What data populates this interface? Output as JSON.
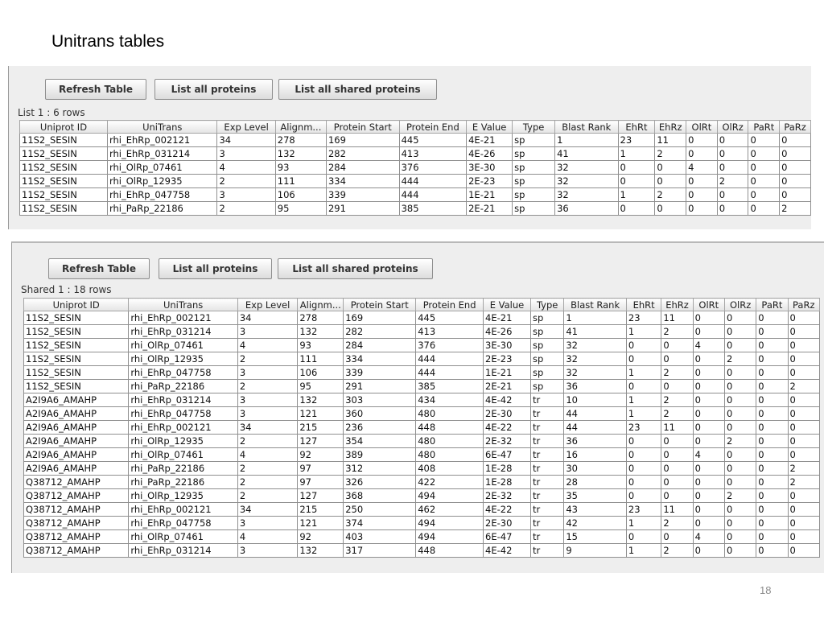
{
  "slide": {
    "title": "Unitrans tables",
    "page_number": "18"
  },
  "columns": [
    "Uniprot ID",
    "UniTrans",
    "Exp Level",
    "Alignm...",
    "Protein Start",
    "Protein End",
    "E Value",
    "Type",
    "Blast Rank",
    "EhRt",
    "EhRz",
    "OlRt",
    "OlRz",
    "PaRt",
    "PaRz"
  ],
  "buttons": {
    "refresh": "Refresh Table",
    "list_all": "List all proteins",
    "list_shared": "List all shared proteins"
  },
  "list_table": {
    "row_count_label": "List 1 : 6 rows",
    "rows": [
      [
        "11S2_SESIN",
        "rhi_EhRp_002121",
        "34",
        "278",
        "169",
        "445",
        "4E-21",
        "sp",
        "1",
        "23",
        "11",
        "0",
        "0",
        "0",
        "0"
      ],
      [
        "11S2_SESIN",
        "rhi_EhRp_031214",
        "3",
        "132",
        "282",
        "413",
        "4E-26",
        "sp",
        "41",
        "1",
        "2",
        "0",
        "0",
        "0",
        "0"
      ],
      [
        "11S2_SESIN",
        "rhi_OlRp_07461",
        "4",
        "93",
        "284",
        "376",
        "3E-30",
        "sp",
        "32",
        "0",
        "0",
        "4",
        "0",
        "0",
        "0"
      ],
      [
        "11S2_SESIN",
        "rhi_OlRp_12935",
        "2",
        "111",
        "334",
        "444",
        "2E-23",
        "sp",
        "32",
        "0",
        "0",
        "0",
        "2",
        "0",
        "0"
      ],
      [
        "11S2_SESIN",
        "rhi_EhRp_047758",
        "3",
        "106",
        "339",
        "444",
        "1E-21",
        "sp",
        "32",
        "1",
        "2",
        "0",
        "0",
        "0",
        "0"
      ],
      [
        "11S2_SESIN",
        "rhi_PaRp_22186",
        "2",
        "95",
        "291",
        "385",
        "2E-21",
        "sp",
        "36",
        "0",
        "0",
        "0",
        "0",
        "0",
        "2"
      ]
    ]
  },
  "shared_table": {
    "row_count_label": "Shared 1 : 18 rows",
    "rows": [
      [
        "11S2_SESIN",
        "rhi_EhRp_002121",
        "34",
        "278",
        "169",
        "445",
        "4E-21",
        "sp",
        "1",
        "23",
        "11",
        "0",
        "0",
        "0",
        "0"
      ],
      [
        "11S2_SESIN",
        "rhi_EhRp_031214",
        "3",
        "132",
        "282",
        "413",
        "4E-26",
        "sp",
        "41",
        "1",
        "2",
        "0",
        "0",
        "0",
        "0"
      ],
      [
        "11S2_SESIN",
        "rhi_OlRp_07461",
        "4",
        "93",
        "284",
        "376",
        "3E-30",
        "sp",
        "32",
        "0",
        "0",
        "4",
        "0",
        "0",
        "0"
      ],
      [
        "11S2_SESIN",
        "rhi_OlRp_12935",
        "2",
        "111",
        "334",
        "444",
        "2E-23",
        "sp",
        "32",
        "0",
        "0",
        "0",
        "2",
        "0",
        "0"
      ],
      [
        "11S2_SESIN",
        "rhi_EhRp_047758",
        "3",
        "106",
        "339",
        "444",
        "1E-21",
        "sp",
        "32",
        "1",
        "2",
        "0",
        "0",
        "0",
        "0"
      ],
      [
        "11S2_SESIN",
        "rhi_PaRp_22186",
        "2",
        "95",
        "291",
        "385",
        "2E-21",
        "sp",
        "36",
        "0",
        "0",
        "0",
        "0",
        "0",
        "2"
      ],
      [
        "A2I9A6_AMAHP",
        "rhi_EhRp_031214",
        "3",
        "132",
        "303",
        "434",
        "4E-42",
        "tr",
        "10",
        "1",
        "2",
        "0",
        "0",
        "0",
        "0"
      ],
      [
        "A2I9A6_AMAHP",
        "rhi_EhRp_047758",
        "3",
        "121",
        "360",
        "480",
        "2E-30",
        "tr",
        "44",
        "1",
        "2",
        "0",
        "0",
        "0",
        "0"
      ],
      [
        "A2I9A6_AMAHP",
        "rhi_EhRp_002121",
        "34",
        "215",
        "236",
        "448",
        "4E-22",
        "tr",
        "44",
        "23",
        "11",
        "0",
        "0",
        "0",
        "0"
      ],
      [
        "A2I9A6_AMAHP",
        "rhi_OlRp_12935",
        "2",
        "127",
        "354",
        "480",
        "2E-32",
        "tr",
        "36",
        "0",
        "0",
        "0",
        "2",
        "0",
        "0"
      ],
      [
        "A2I9A6_AMAHP",
        "rhi_OlRp_07461",
        "4",
        "92",
        "389",
        "480",
        "6E-47",
        "tr",
        "16",
        "0",
        "0",
        "4",
        "0",
        "0",
        "0"
      ],
      [
        "A2I9A6_AMAHP",
        "rhi_PaRp_22186",
        "2",
        "97",
        "312",
        "408",
        "1E-28",
        "tr",
        "30",
        "0",
        "0",
        "0",
        "0",
        "0",
        "2"
      ],
      [
        "Q38712_AMAHP",
        "rhi_PaRp_22186",
        "2",
        "97",
        "326",
        "422",
        "1E-28",
        "tr",
        "28",
        "0",
        "0",
        "0",
        "0",
        "0",
        "2"
      ],
      [
        "Q38712_AMAHP",
        "rhi_OlRp_12935",
        "2",
        "127",
        "368",
        "494",
        "2E-32",
        "tr",
        "35",
        "0",
        "0",
        "0",
        "2",
        "0",
        "0"
      ],
      [
        "Q38712_AMAHP",
        "rhi_EhRp_002121",
        "34",
        "215",
        "250",
        "462",
        "4E-22",
        "tr",
        "43",
        "23",
        "11",
        "0",
        "0",
        "0",
        "0"
      ],
      [
        "Q38712_AMAHP",
        "rhi_EhRp_047758",
        "3",
        "121",
        "374",
        "494",
        "2E-30",
        "tr",
        "42",
        "1",
        "2",
        "0",
        "0",
        "0",
        "0"
      ],
      [
        "Q38712_AMAHP",
        "rhi_OlRp_07461",
        "4",
        "92",
        "403",
        "494",
        "6E-47",
        "tr",
        "15",
        "0",
        "0",
        "4",
        "0",
        "0",
        "0"
      ],
      [
        "Q38712_AMAHP",
        "rhi_EhRp_031214",
        "3",
        "132",
        "317",
        "448",
        "4E-42",
        "tr",
        "9",
        "1",
        "2",
        "0",
        "0",
        "0",
        "0"
      ]
    ]
  }
}
